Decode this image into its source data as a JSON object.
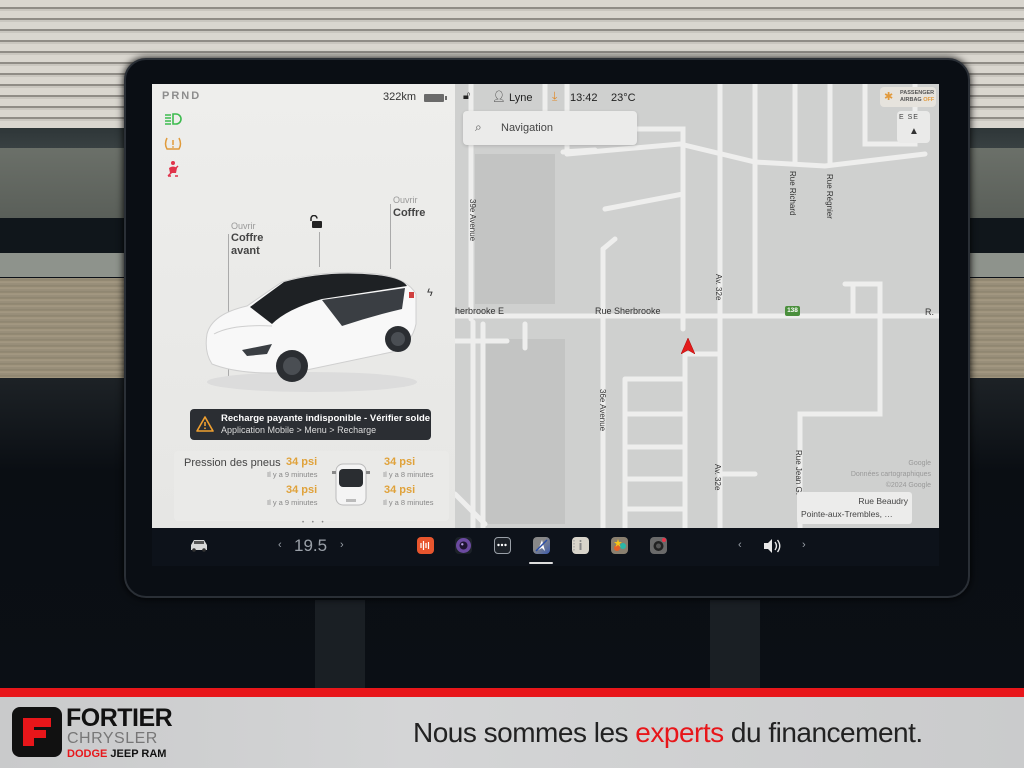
{
  "status_bar": {
    "gear_indicator": "PRND",
    "range": "322km",
    "driver_icon": "person-icon",
    "driver_name": "Lyne",
    "time": "13:42",
    "temperature": "23°C",
    "airbag_line1": "PASSENGER",
    "airbag_line2": "AIRBAG",
    "airbag_state": "OFF"
  },
  "indicators": [
    {
      "name": "headlights-icon",
      "glyph": "≣D",
      "color": "#3dbb4f"
    },
    {
      "name": "tire-pressure-warning-icon",
      "glyph": "(!)",
      "color": "#e09a3a"
    },
    {
      "name": "seatbelt-warning-icon",
      "glyph": "⚠",
      "color": "#e0334a"
    }
  ],
  "car_controls": {
    "frunk_action": "Ouvrir",
    "frunk_label_1": "Coffre",
    "frunk_label_2": "avant",
    "trunk_action": "Ouvrir",
    "trunk_label": "Coffre"
  },
  "alert": {
    "title": "Recharge payante indisponible - Vérifier solde",
    "subtitle": "Application Mobile > Menu > Recharge"
  },
  "tire_pressure": {
    "title": "Pression des pneus",
    "front_left": {
      "value": "34 psi",
      "updated": "Il y a 9 minutes"
    },
    "front_right": {
      "value": "34 psi",
      "updated": "Il y a 8 minutes"
    },
    "rear_left": {
      "value": "34 psi",
      "updated": "Il y a 9 minutes"
    },
    "rear_right": {
      "value": "34 psi",
      "updated": "Il y a 8 minutes"
    }
  },
  "page_dots": "• • •",
  "map": {
    "search_placeholder": "Navigation",
    "compass_dirs": "E SE",
    "streets": {
      "sherbrooke_e": "herbrooke E",
      "sherbrooke": "Rue Sherbrooke",
      "r_cut": "R.",
      "ave39": "39e Avenue",
      "ave36": "36e Avenue",
      "av32_top": "Av. 32e",
      "av32_bottom": "Av. 32e",
      "richard": "Rue Richard",
      "regnier": "Rue Régnier",
      "jean_g": "Rue Jean G."
    },
    "highway_shield": "138",
    "attribution_1": "Google",
    "attribution_2": "Données cartographiques",
    "attribution_3": "©2024 Google",
    "destination_street": "Rue Beaudry",
    "destination_city": "Pointe-aux-Trembles, …"
  },
  "taskbar": {
    "cabin_temp": "19.5",
    "temp_down": "‹",
    "temp_up": "›",
    "vol_down": "‹",
    "vol_up": "›",
    "apps": [
      {
        "name": "audio-app-icon",
        "color": "#e8562e"
      },
      {
        "name": "camera-app-icon",
        "color": "#5a3c8c"
      },
      {
        "name": "more-apps-icon",
        "color": "#1c2128"
      },
      {
        "name": "navigation-app-icon",
        "color": "#4a5fa0"
      },
      {
        "name": "manual-app-icon",
        "color": "#d8d4ca"
      },
      {
        "name": "toybox-app-icon",
        "color": "#8a8070"
      },
      {
        "name": "dashcam-app-icon",
        "color": "#6a6a6a"
      }
    ]
  },
  "banner": {
    "brand_line1": "FORTIER",
    "brand_line2": "CHRYSLER",
    "brand_dodge": "DODGE",
    "brand_rest": " JEEP RAM",
    "slogan_before": "Nous sommes les ",
    "slogan_accent": "experts",
    "slogan_after": " du financement.",
    "accent_color": "#e8161a"
  }
}
